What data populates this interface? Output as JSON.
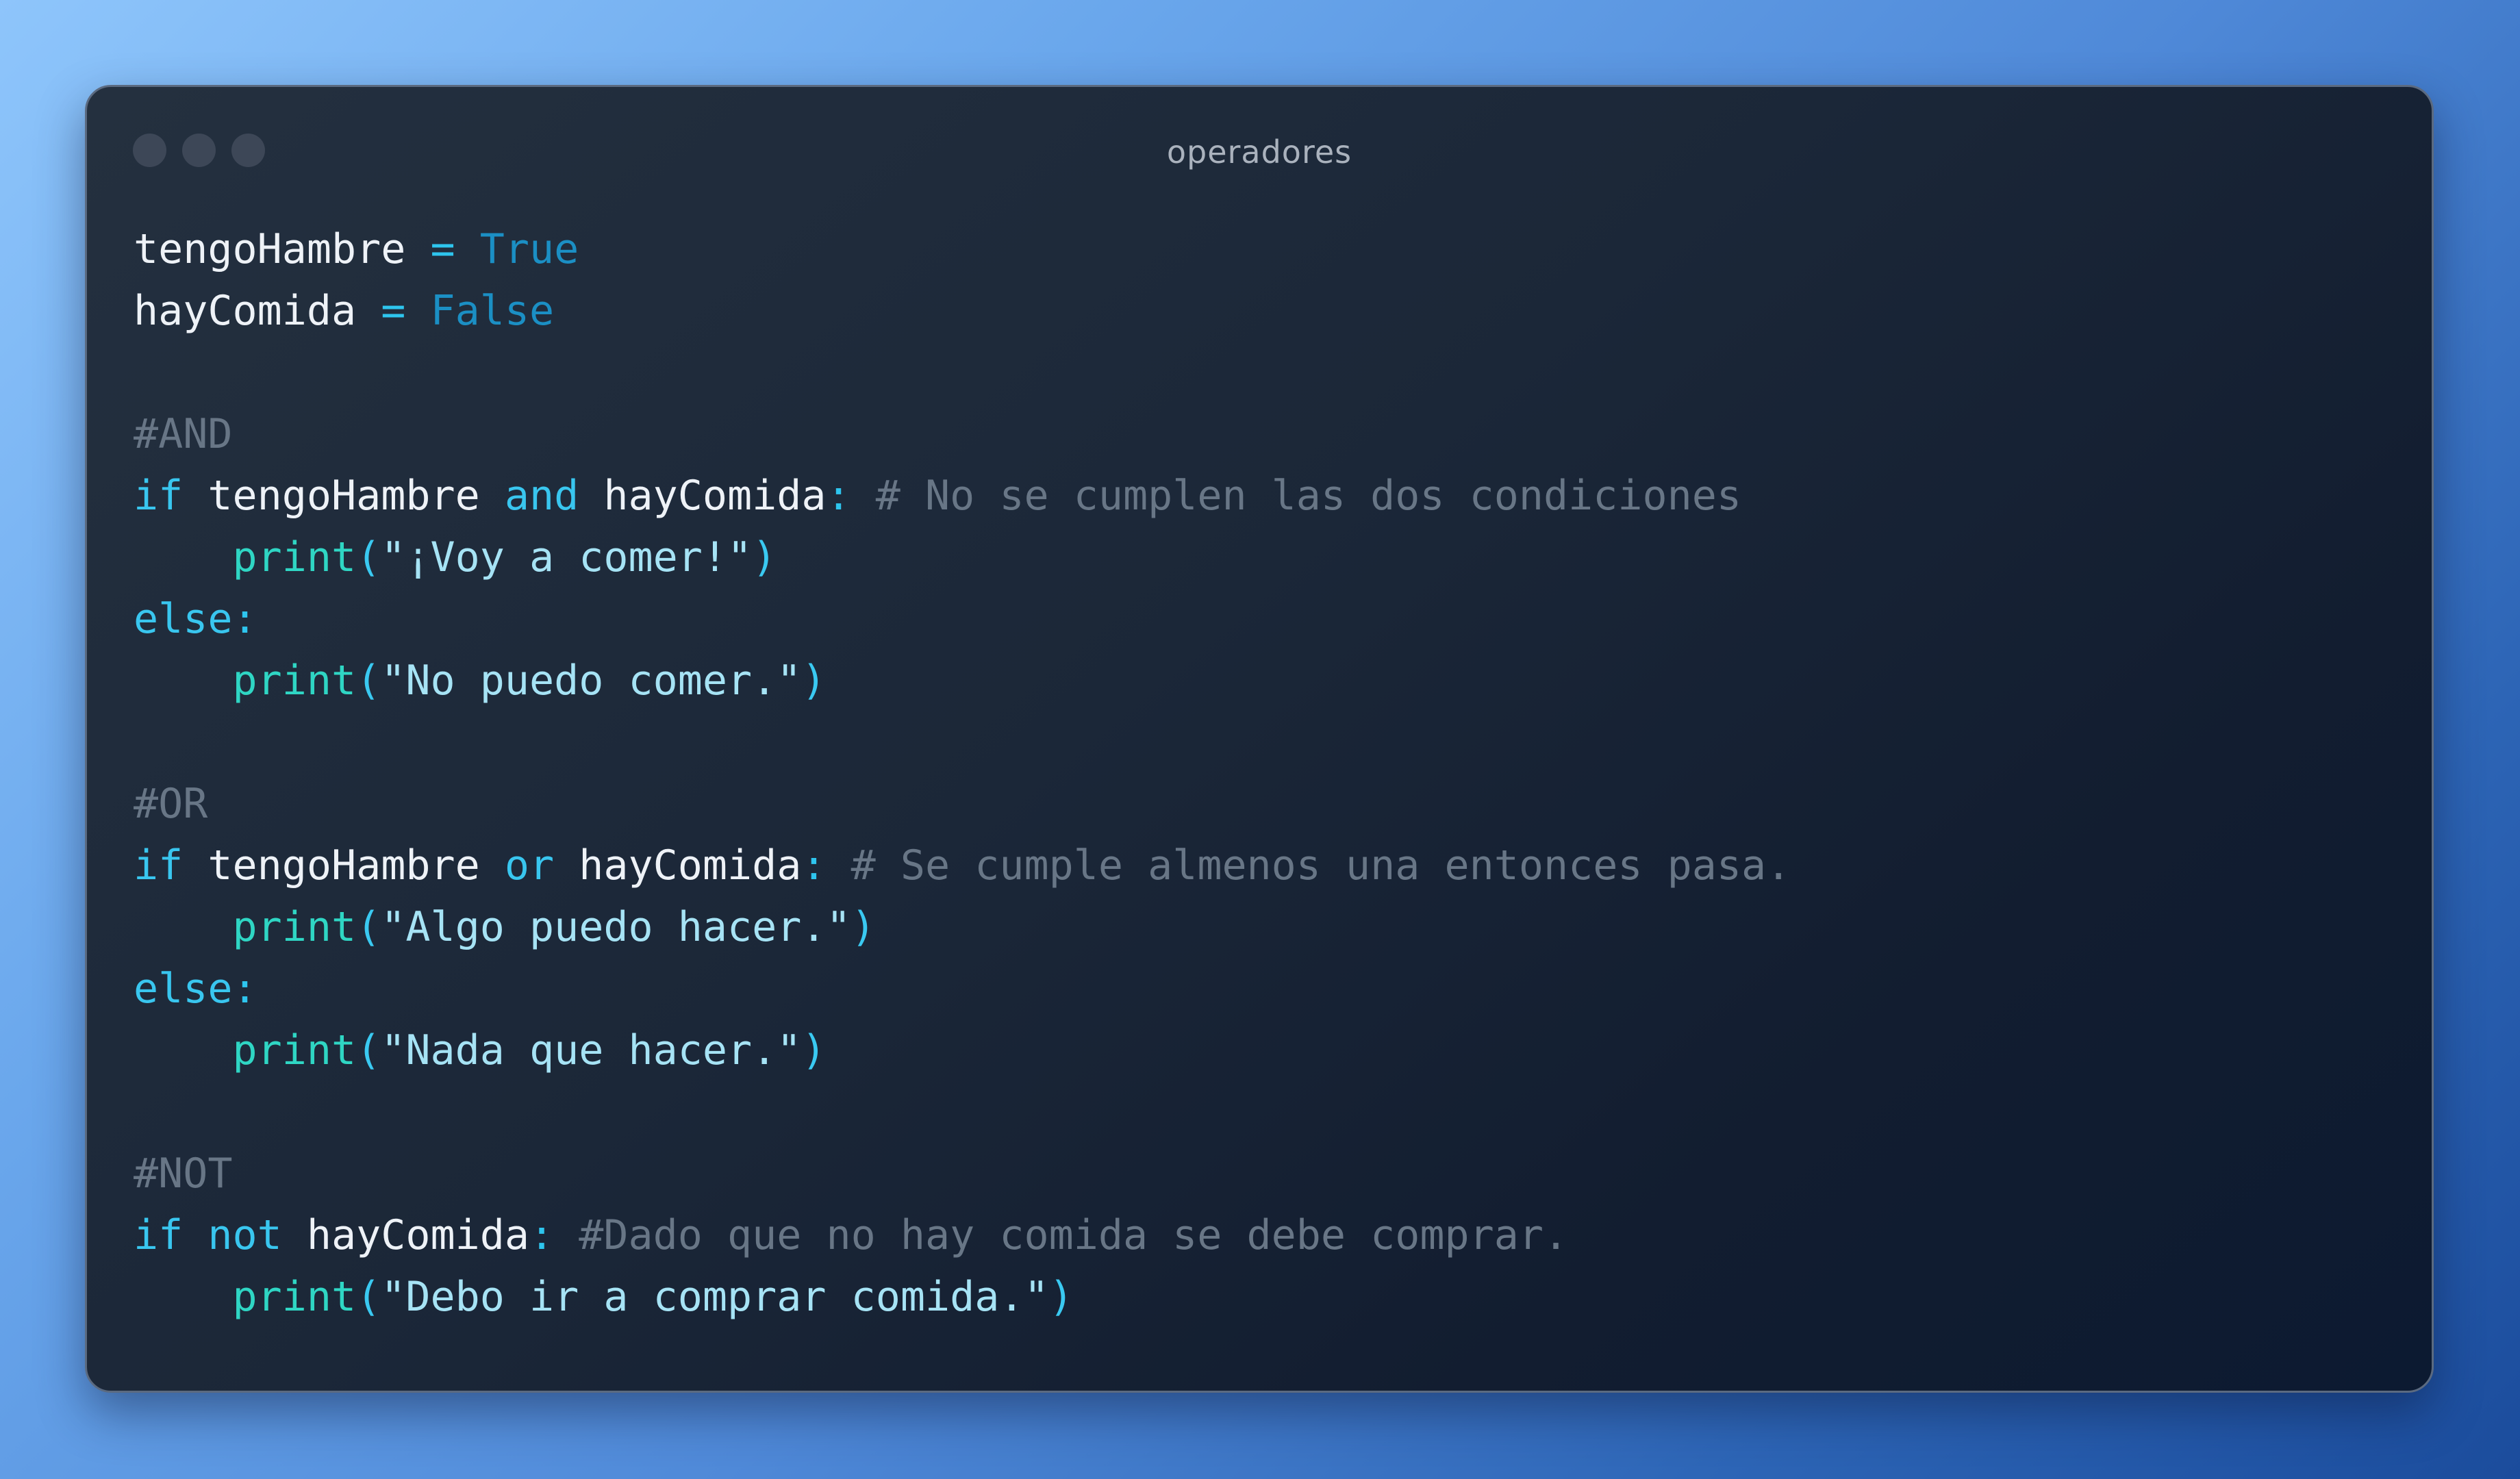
{
  "window": {
    "title": "operadores"
  },
  "code": {
    "lines": [
      [
        {
          "t": "tengoHambre",
          "k": "var"
        },
        {
          "t": " ",
          "k": "var"
        },
        {
          "t": "=",
          "k": "op"
        },
        {
          "t": " ",
          "k": "var"
        },
        {
          "t": "True",
          "k": "bool"
        }
      ],
      [
        {
          "t": "hayComida",
          "k": "var"
        },
        {
          "t": " ",
          "k": "var"
        },
        {
          "t": "=",
          "k": "op"
        },
        {
          "t": " ",
          "k": "var"
        },
        {
          "t": "False",
          "k": "bool"
        }
      ],
      [],
      [
        {
          "t": "#AND",
          "k": "cm"
        }
      ],
      [
        {
          "t": "if",
          "k": "kw"
        },
        {
          "t": " ",
          "k": "var"
        },
        {
          "t": "tengoHambre",
          "k": "var"
        },
        {
          "t": " ",
          "k": "var"
        },
        {
          "t": "and",
          "k": "kw"
        },
        {
          "t": " ",
          "k": "var"
        },
        {
          "t": "hayComida",
          "k": "var"
        },
        {
          "t": ":",
          "k": "op"
        },
        {
          "t": " # No se cumplen las dos condiciones",
          "k": "cm"
        }
      ],
      [
        {
          "t": "    ",
          "k": "var"
        },
        {
          "t": "print",
          "k": "fn"
        },
        {
          "t": "(",
          "k": "paren"
        },
        {
          "t": "\"¡Voy a comer!\"",
          "k": "str"
        },
        {
          "t": ")",
          "k": "paren"
        }
      ],
      [
        {
          "t": "else",
          "k": "kw"
        },
        {
          "t": ":",
          "k": "op"
        }
      ],
      [
        {
          "t": "    ",
          "k": "var"
        },
        {
          "t": "print",
          "k": "fn"
        },
        {
          "t": "(",
          "k": "paren"
        },
        {
          "t": "\"No puedo comer.\"",
          "k": "str"
        },
        {
          "t": ")",
          "k": "paren"
        }
      ],
      [],
      [
        {
          "t": "#OR",
          "k": "cm"
        }
      ],
      [
        {
          "t": "if",
          "k": "kw"
        },
        {
          "t": " ",
          "k": "var"
        },
        {
          "t": "tengoHambre",
          "k": "var"
        },
        {
          "t": " ",
          "k": "var"
        },
        {
          "t": "or",
          "k": "kw"
        },
        {
          "t": " ",
          "k": "var"
        },
        {
          "t": "hayComida",
          "k": "var"
        },
        {
          "t": ":",
          "k": "op"
        },
        {
          "t": " # Se cumple almenos una entonces pasa.",
          "k": "cm"
        }
      ],
      [
        {
          "t": "    ",
          "k": "var"
        },
        {
          "t": "print",
          "k": "fn"
        },
        {
          "t": "(",
          "k": "paren"
        },
        {
          "t": "\"Algo puedo hacer.\"",
          "k": "str"
        },
        {
          "t": ")",
          "k": "paren"
        }
      ],
      [
        {
          "t": "else",
          "k": "kw"
        },
        {
          "t": ":",
          "k": "op"
        }
      ],
      [
        {
          "t": "    ",
          "k": "var"
        },
        {
          "t": "print",
          "k": "fn"
        },
        {
          "t": "(",
          "k": "paren"
        },
        {
          "t": "\"Nada que hacer.\"",
          "k": "str"
        },
        {
          "t": ")",
          "k": "paren"
        }
      ],
      [],
      [
        {
          "t": "#NOT",
          "k": "cm"
        }
      ],
      [
        {
          "t": "if",
          "k": "kw"
        },
        {
          "t": " ",
          "k": "var"
        },
        {
          "t": "not",
          "k": "kw"
        },
        {
          "t": " ",
          "k": "var"
        },
        {
          "t": "hayComida",
          "k": "var"
        },
        {
          "t": ":",
          "k": "op"
        },
        {
          "t": " #Dado que no hay comida se debe comprar.",
          "k": "cm"
        }
      ],
      [
        {
          "t": "    ",
          "k": "var"
        },
        {
          "t": "print",
          "k": "fn"
        },
        {
          "t": "(",
          "k": "paren"
        },
        {
          "t": "\"Debo ir a comprar comida.\"",
          "k": "str"
        },
        {
          "t": ")",
          "k": "paren"
        }
      ]
    ]
  }
}
